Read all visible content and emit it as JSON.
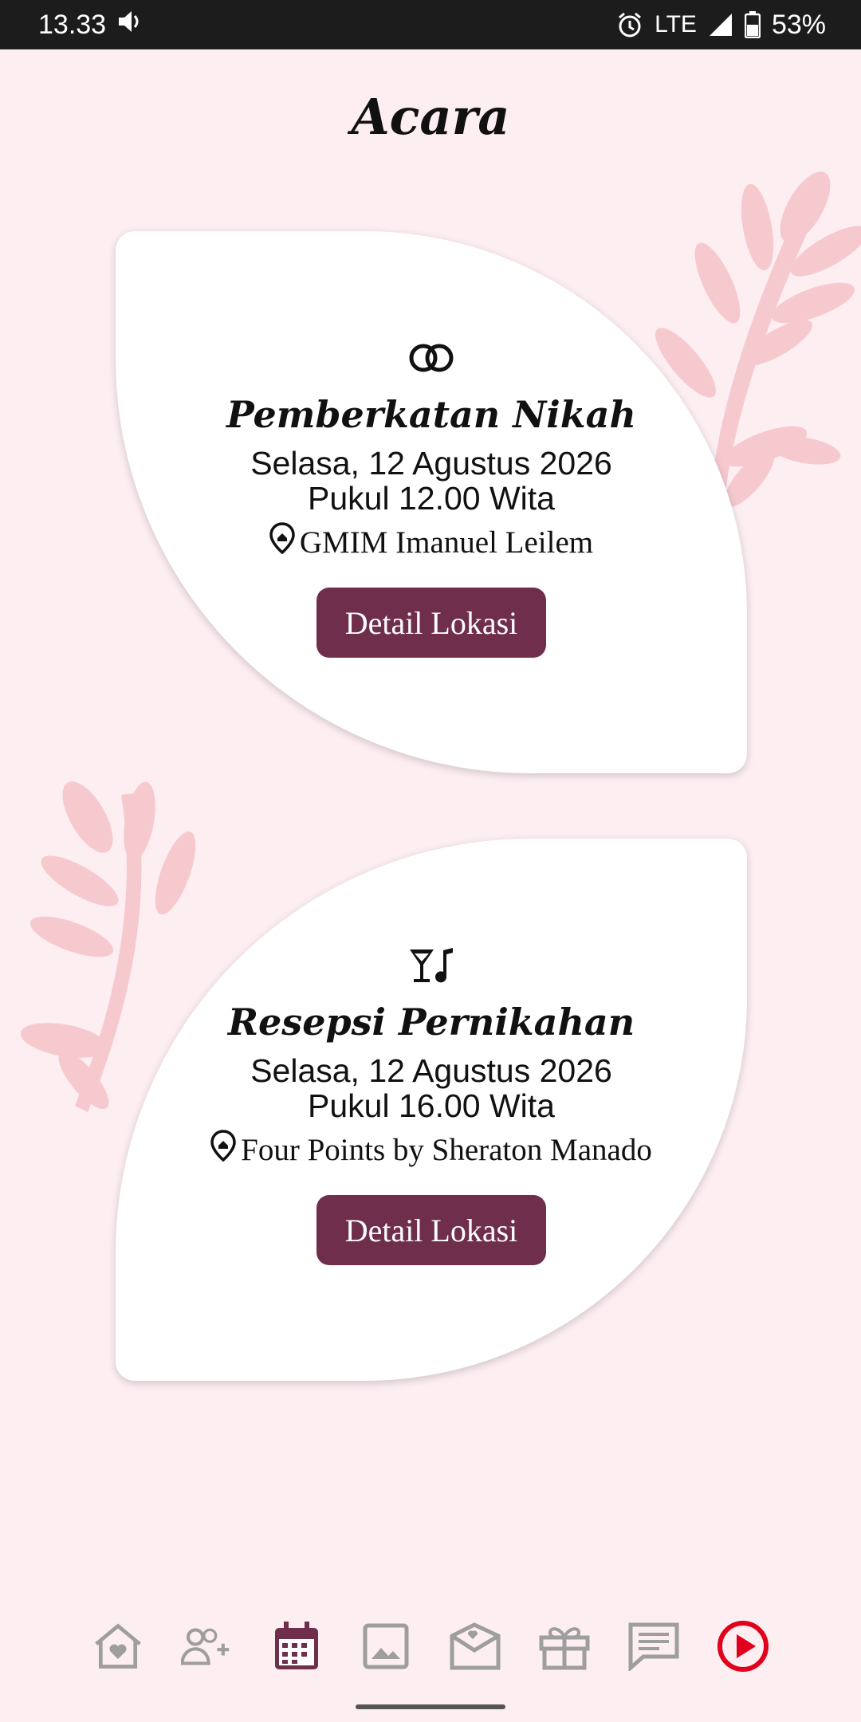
{
  "status_bar": {
    "time": "13.33",
    "network": "LTE",
    "battery": "53%",
    "icons": [
      "volume-icon",
      "alarm-icon",
      "signal-icon",
      "battery-icon"
    ]
  },
  "page": {
    "title": "Acara"
  },
  "events": [
    {
      "icon": "wedding-rings-icon",
      "title": "Pemberkatan Nikah",
      "date": "Selasa, 12 Agustus 2026",
      "time": "Pukul 12.00 Wita",
      "location": "GMIM Imanuel Leilem",
      "button_label": "Detail Lokasi"
    },
    {
      "icon": "cocktail-music-icon",
      "title": "Resepsi Pernikahan",
      "date": "Selasa, 12 Agustus 2026",
      "time": "Pukul 16.00 Wita",
      "location": "Four Points by Sheraton Manado",
      "button_label": "Detail Lokasi"
    }
  ],
  "bottom_nav": {
    "items": [
      "home-heart-icon",
      "add-guest-icon",
      "calendar-icon",
      "gallery-icon",
      "love-letter-icon",
      "gift-icon",
      "message-icon",
      "play-icon"
    ],
    "active": "calendar-icon"
  },
  "colors": {
    "background": "#fdeef2",
    "button": "#6e2e4c",
    "leaf": "#f6c9cf",
    "nav_active": "#6e2e4c",
    "nav_inactive": "#9e9e9e",
    "play": "#e0001b"
  }
}
